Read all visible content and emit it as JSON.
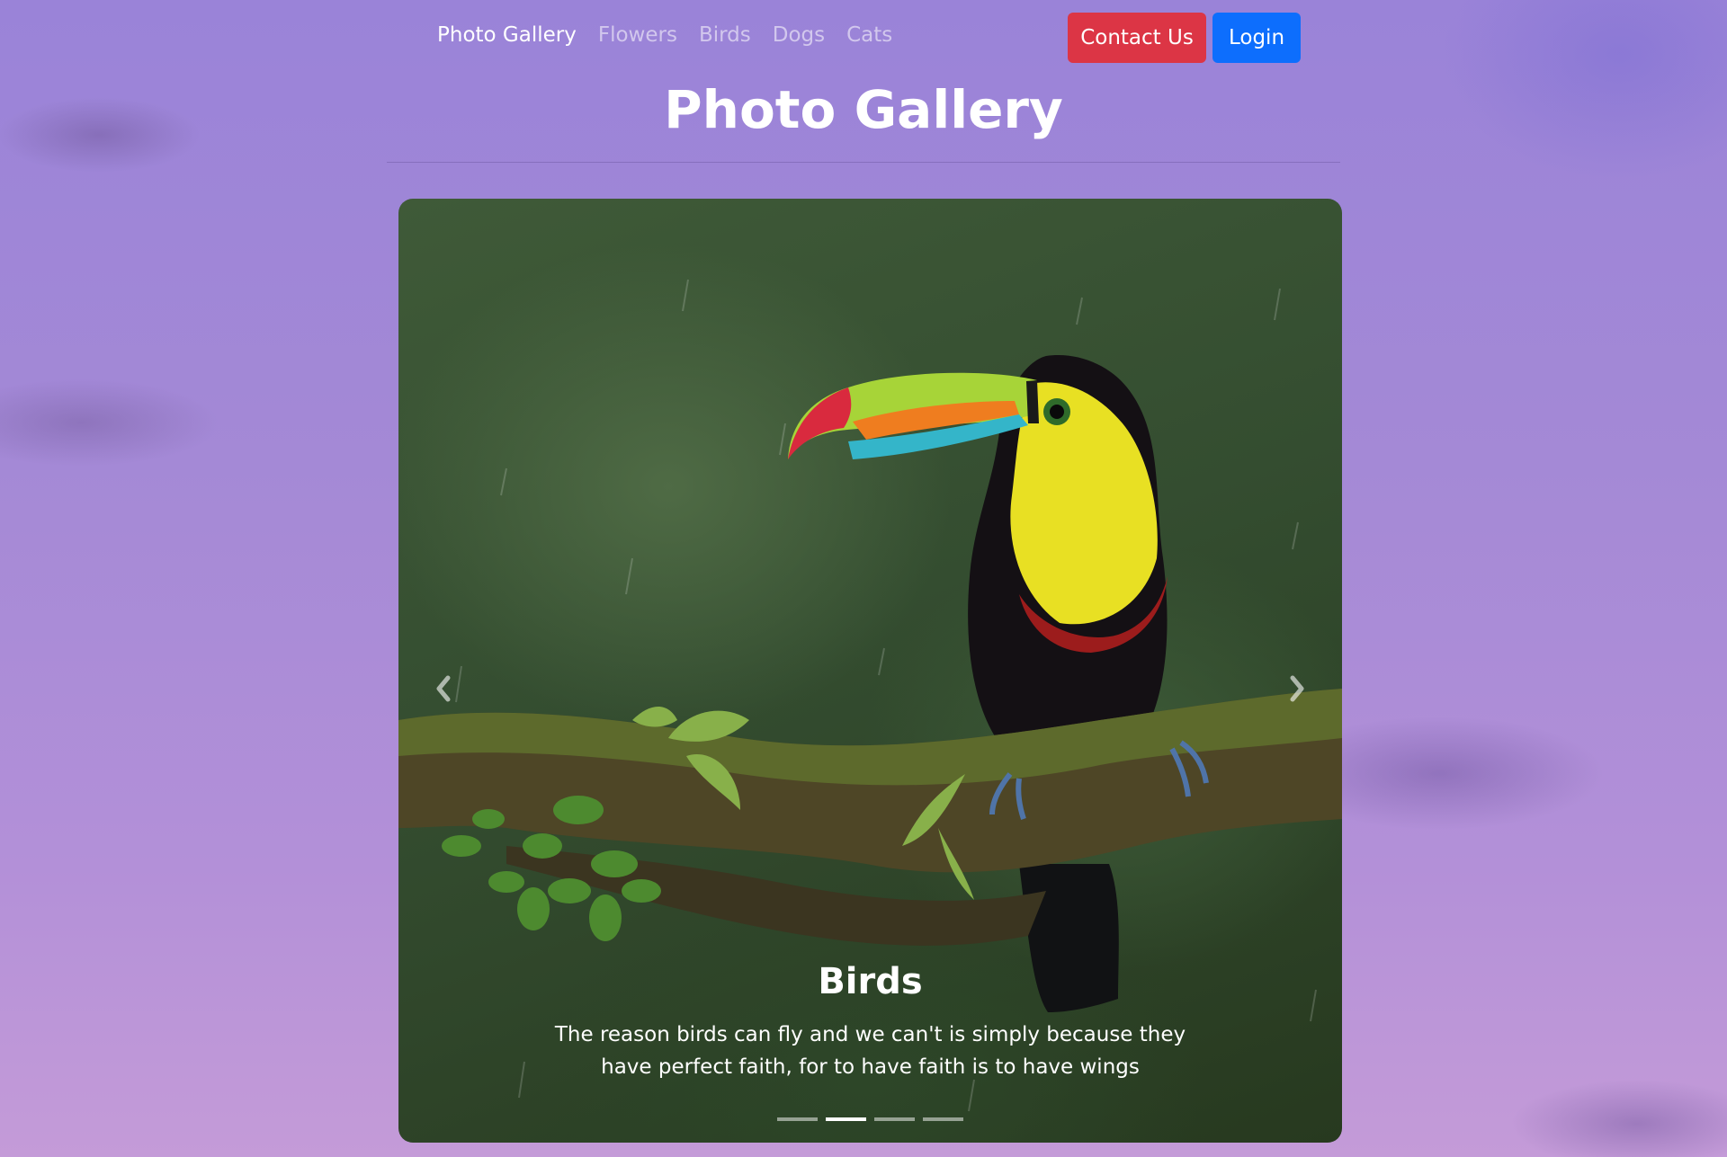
{
  "navbar": {
    "links": [
      "Photo Gallery",
      "Flowers",
      "Birds",
      "Dogs",
      "Cats"
    ],
    "contact_label": "Contact Us",
    "login_label": "Login"
  },
  "page": {
    "title": "Photo Gallery"
  },
  "carousel": {
    "slide_title": "Birds",
    "slide_text": "The reason birds can fly and we can't is simply because they have perfect faith, for to have faith is to have wings",
    "image_subject": "toucan on mossy branch",
    "slide_count": 4,
    "active_slide": 2
  },
  "icons": {
    "prev": "chevron-left-icon",
    "next": "chevron-right-icon"
  },
  "colors": {
    "contact_button": "#dc3545",
    "login_button": "#0d6efd",
    "background": "#a489d6"
  }
}
